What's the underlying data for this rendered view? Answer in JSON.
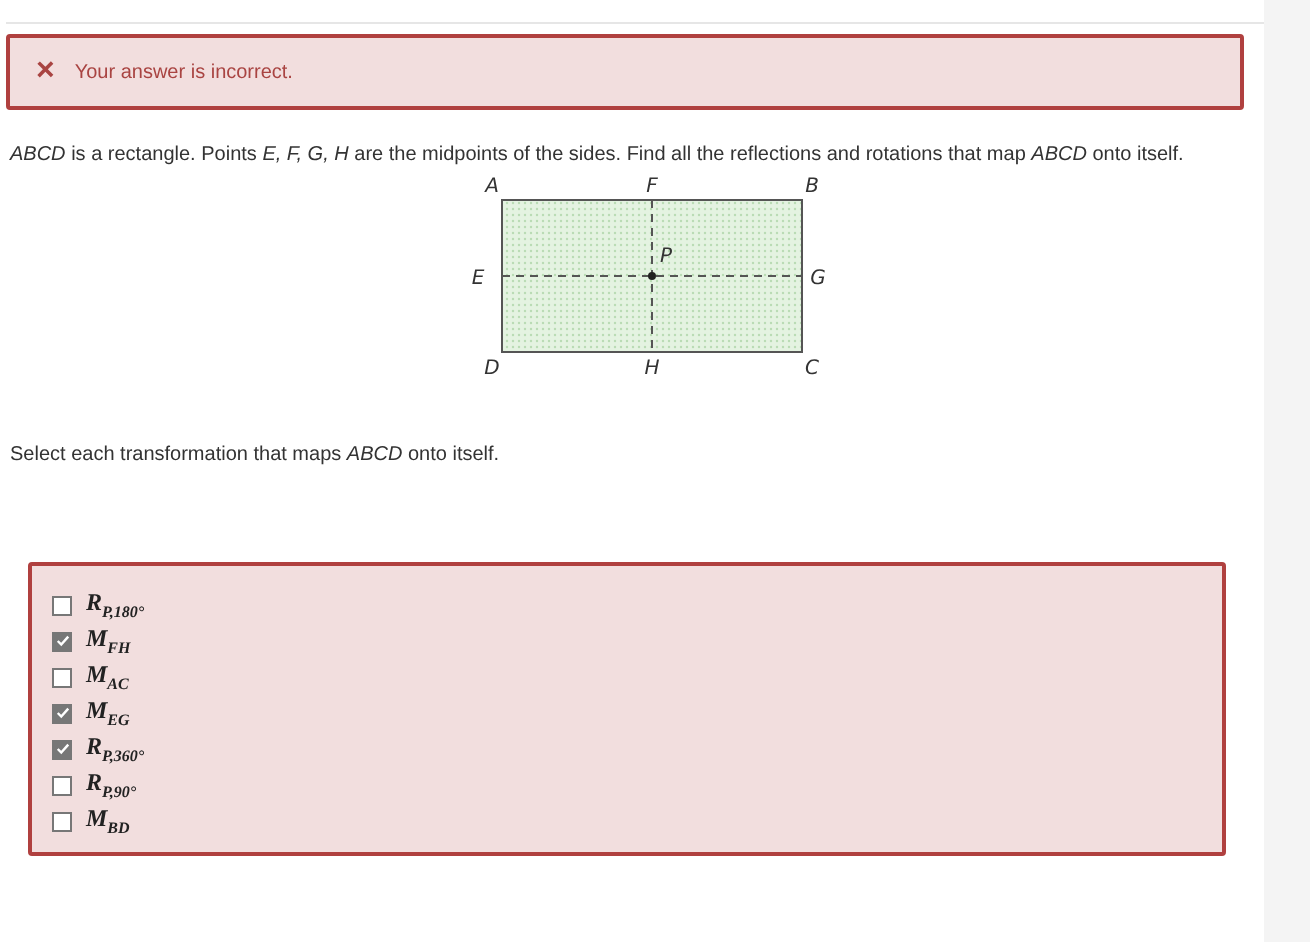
{
  "alert": {
    "icon": "×",
    "message": "Your answer is incorrect."
  },
  "problem": "*ABCD* is a rectangle. Points *E, F, G, H* are the midpoints of the sides. Find all the reflections and rotations that map *ABCD* onto itself.",
  "diagram": {
    "labels": [
      "A",
      "F",
      "B",
      "E",
      "P",
      "G",
      "D",
      "H",
      "C"
    ]
  },
  "prompt": "Select each transformation that maps *ABCD* onto itself.",
  "options": [
    {
      "label": "R$_{P,180°}$",
      "checked": false
    },
    {
      "label": "M$_{FH}$",
      "checked": true
    },
    {
      "label": "M$_{AC}$",
      "checked": false
    },
    {
      "label": "M$_{EG}$",
      "checked": true
    },
    {
      "label": "R$_{P,360°}$",
      "checked": true
    },
    {
      "label": "R$_{P,90°}$",
      "checked": false
    },
    {
      "label": "M$_{BD}$",
      "checked": false
    }
  ]
}
